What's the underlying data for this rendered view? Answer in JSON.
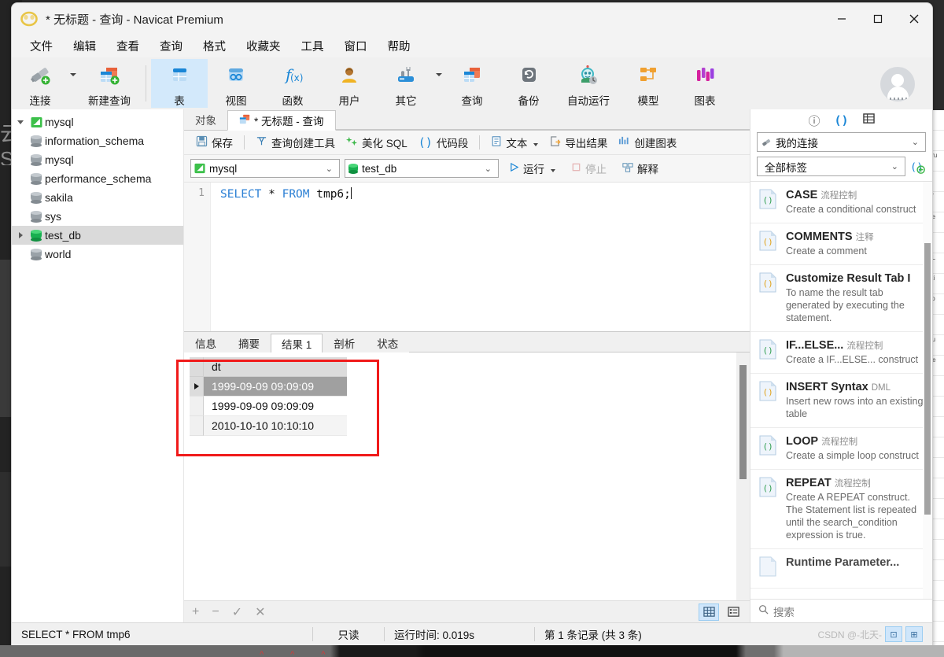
{
  "window": {
    "title": "* 无标题 - 查询 - Navicat Premium",
    "minimize": "—",
    "maximize": "▢",
    "close": "✕"
  },
  "menubar": {
    "items": [
      "文件",
      "编辑",
      "查看",
      "查询",
      "格式",
      "收藏夹",
      "工具",
      "窗口",
      "帮助"
    ]
  },
  "toolbar": {
    "items": [
      {
        "label": "连接",
        "icon": "connection-icon"
      },
      {
        "label": "新建查询",
        "icon": "new-query-icon"
      },
      {
        "label": "表",
        "icon": "table-icon"
      },
      {
        "label": "视图",
        "icon": "view-icon"
      },
      {
        "label": "函数",
        "icon": "function-icon"
      },
      {
        "label": "用户",
        "icon": "user-icon"
      },
      {
        "label": "其它",
        "icon": "other-icon"
      },
      {
        "label": "查询",
        "icon": "query-icon"
      },
      {
        "label": "备份",
        "icon": "backup-icon"
      },
      {
        "label": "自动运行",
        "icon": "automation-icon"
      },
      {
        "label": "模型",
        "icon": "model-icon"
      },
      {
        "label": "图表",
        "icon": "chart-icon"
      }
    ],
    "active": "表"
  },
  "tree": {
    "root": {
      "label": "mysql",
      "icon": "mysql-connection-icon",
      "expanded": true
    },
    "items": [
      {
        "label": "information_schema",
        "selected": false,
        "color": "#9aa2a8"
      },
      {
        "label": "mysql",
        "selected": false,
        "color": "#9aa2a8"
      },
      {
        "label": "performance_schema",
        "selected": false,
        "color": "#9aa2a8"
      },
      {
        "label": "sakila",
        "selected": false,
        "color": "#9aa2a8"
      },
      {
        "label": "sys",
        "selected": false,
        "color": "#9aa2a8"
      },
      {
        "label": "test_db",
        "selected": true,
        "color": "#18b050"
      },
      {
        "label": "world",
        "selected": false,
        "color": "#9aa2a8"
      }
    ]
  },
  "tabs": {
    "object_tab": "对象",
    "query_tab": "* 无标题 - 查询"
  },
  "query_toolbar": {
    "save": "保存",
    "query_builder": "查询创建工具",
    "beautify_sql": "美化 SQL",
    "snippets": "代码段",
    "text": "文本",
    "export_result": "导出结果",
    "create_chart": "创建图表"
  },
  "query_toolbar2": {
    "connection": "mysql",
    "database": "test_db",
    "run": "运行",
    "stop": "停止",
    "explain": "解释"
  },
  "editor": {
    "line_number": "1",
    "sql_keyword1": "SELECT",
    "sql_star": " * ",
    "sql_keyword2": "FROM",
    "sql_table": " tmp6;"
  },
  "result_tabs": {
    "items": [
      "信息",
      "摘要",
      "结果 1",
      "剖析",
      "状态"
    ],
    "active": "结果 1"
  },
  "result_grid": {
    "columns": [
      "dt"
    ],
    "rows": [
      {
        "dt": "1999-09-09 09:09:09",
        "selected": true
      },
      {
        "dt": "1999-09-09 09:09:09",
        "selected": false
      },
      {
        "dt": "2010-10-10 10:10:10",
        "selected": false
      }
    ]
  },
  "result_footer": {
    "add": "+",
    "remove": "−",
    "confirm": "✓",
    "cancel": "✕",
    "grid_view": "grid-view-icon",
    "form_view": "form-view-icon"
  },
  "right_panel": {
    "icons": [
      "info-icon",
      "code-icon",
      "grid-icon"
    ],
    "connection_select": "我的连接",
    "tag_select": "全部标签",
    "add_snippet": "add-snippet-icon",
    "search_placeholder": "搜索",
    "snippets": [
      {
        "title": "CASE",
        "category": "流程控制",
        "desc": "Create a conditional construct",
        "color": "#2f9e4f"
      },
      {
        "title": "COMMENTS",
        "category": "注释",
        "desc": "Create a comment",
        "color": "#e0a21a"
      },
      {
        "title": "Customize Result Tab I",
        "category": "",
        "desc": "To name the result tab generated by executing the statement.",
        "color": "#e0a21a"
      },
      {
        "title": "IF...ELSE...",
        "category": "流程控制",
        "desc": "Create a IF...ELSE... construct",
        "color": "#2f9e4f"
      },
      {
        "title": "INSERT Syntax",
        "category": "DML",
        "desc": "Insert new rows into an existing table",
        "color": "#e0a21a"
      },
      {
        "title": "LOOP",
        "category": "流程控制",
        "desc": "Create a simple loop construct",
        "color": "#2f9e4f"
      },
      {
        "title": "REPEAT",
        "category": "流程控制",
        "desc": "Create A REPEAT construct. The Statement list is repeated until the search_condition expression is true.",
        "color": "#2f9e4f"
      },
      {
        "title": "Runtime Parameter...",
        "category": "",
        "desc": "",
        "color": "#6c8ebf"
      }
    ]
  },
  "statusbar": {
    "sql": "SELECT * FROM tmp6",
    "readonly": "只读",
    "runtime": "运行时间: 0.019s",
    "records": "第 1 条记录 (共 3 条)",
    "watermark": "CSDN @-北天-"
  }
}
